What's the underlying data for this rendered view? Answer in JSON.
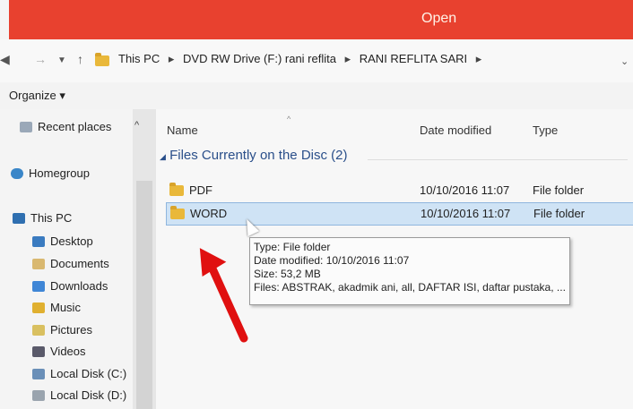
{
  "window": {
    "title": "Open"
  },
  "address": {
    "crumbs": [
      "This PC",
      "DVD RW Drive (F:) rani reflita",
      "RANI REFLITA SARI"
    ],
    "separator": "▸"
  },
  "toolbar": {
    "organize_label": "Organize ▾"
  },
  "nav_pane": {
    "items": [
      {
        "label": "Recent places",
        "icon": "recent-places-icon"
      },
      {
        "label": "Homegroup",
        "icon": "homegroup-icon"
      },
      {
        "label": "This PC",
        "icon": "computer-icon"
      },
      {
        "label": "Desktop",
        "icon": "desktop-icon"
      },
      {
        "label": "Documents",
        "icon": "documents-icon"
      },
      {
        "label": "Downloads",
        "icon": "downloads-icon"
      },
      {
        "label": "Music",
        "icon": "music-icon"
      },
      {
        "label": "Pictures",
        "icon": "pictures-icon"
      },
      {
        "label": "Videos",
        "icon": "videos-icon"
      },
      {
        "label": "Local Disk (C:)",
        "icon": "drive-icon"
      },
      {
        "label": "Local Disk (D:)",
        "icon": "drive-icon"
      }
    ]
  },
  "columns": {
    "name": "Name",
    "date": "Date modified",
    "type": "Type"
  },
  "group": {
    "label": "Files Currently on the Disc (2)"
  },
  "files": [
    {
      "name": "PDF",
      "date": "10/10/2016 11:07",
      "type": "File folder"
    },
    {
      "name": "WORD",
      "date": "10/10/2016 11:07",
      "type": "File folder"
    }
  ],
  "tooltip": {
    "line1": "Type: File folder",
    "line2": "Date modified: 10/10/2016 11:07",
    "line3": "Size: 53,2 MB",
    "line4": "Files: ABSTRAK, akadmik ani, all, DAFTAR ISI, daftar pustaka, ..."
  },
  "colors": {
    "titlebar": "#e8412f",
    "selection": "#cfe3f5",
    "annotation_arrow": "#e01010"
  }
}
